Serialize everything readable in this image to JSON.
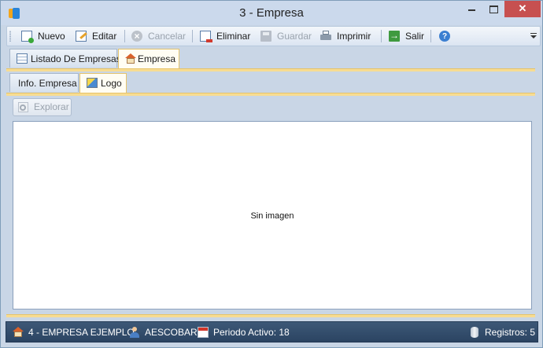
{
  "window": {
    "title": "3 - Empresa",
    "close_glyph": "✕"
  },
  "toolbar": {
    "new_label": "Nuevo",
    "edit_label": "Editar",
    "cancel_label": "Cancelar",
    "delete_label": "Eliminar",
    "save_label": "Guardar",
    "print_label": "Imprimir",
    "exit_label": "Salir"
  },
  "tabs": {
    "list_label": "Listado De Empresas",
    "company_label": "Empresa"
  },
  "subtabs": {
    "info_label": "Info. Empresa",
    "logo_label": "Logo"
  },
  "logo_panel": {
    "explore_label": "Explorar",
    "empty_message": "Sin imagen"
  },
  "statusbar": {
    "company": "4 - EMPRESA EJEMPLO",
    "user": "AESCOBAR",
    "period": "Periodo Activo: 18",
    "records": "Registros: 5"
  },
  "colors": {
    "statusbar_bg": "#2f4a6b",
    "active_tab_border": "#e4c36d",
    "close_button": "#c75050",
    "window_bg": "#c9d6e6"
  }
}
